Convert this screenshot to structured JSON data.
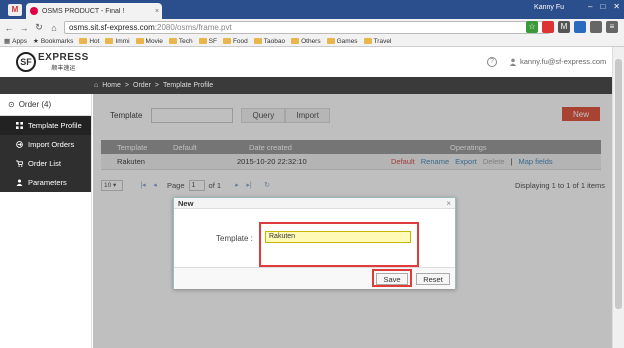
{
  "browser": {
    "gmail_badge": "M",
    "tab_title": "OSMS PRODUCT - Final !",
    "tab_close": "×",
    "user": "Kanny Fu",
    "url_host": "osms.sit.sf-express.com",
    "url_rest": ":2080/osms/frame.pvt",
    "bookmarks": [
      "Apps",
      "Bookmarks",
      "Hot",
      "Immi",
      "Movie",
      "Tech",
      "SF",
      "Food",
      "Taobao",
      "Others",
      "Games",
      "Travel"
    ]
  },
  "header": {
    "logo_mark": "SF",
    "logo_en": "EXPRESS",
    "logo_cn": "顺丰速运",
    "help": "?",
    "user_email": "kanny.fu@sf-express.com"
  },
  "breadcrumb": {
    "home": "Home",
    "sep1": ">",
    "order": "Order",
    "sep2": ">",
    "current": "Template Profile"
  },
  "sidebar": {
    "section": "Order (4)",
    "items": [
      {
        "label": "Template Profile",
        "icon": "grid-icon"
      },
      {
        "label": "Import Orders",
        "icon": "import-icon"
      },
      {
        "label": "Order List",
        "icon": "cart-icon"
      },
      {
        "label": "Parameters",
        "icon": "person-icon"
      }
    ]
  },
  "search": {
    "template_label": "Template",
    "query_label": "Query",
    "import_label": "Import",
    "new_label": "New"
  },
  "grid": {
    "columns": [
      "Template",
      "Default",
      "Date created",
      "Operatings"
    ],
    "rows": [
      {
        "template": "Rakuten",
        "default": "",
        "date": "2015-10-20 22:32:10"
      }
    ],
    "ops": {
      "default": "Default",
      "rename": "Rename",
      "export": "Export",
      "delete": "Delete",
      "sep": "|",
      "map": "Map fields"
    }
  },
  "pager": {
    "page_size": "10",
    "page_label": "Page",
    "page_value": "1",
    "of_label": "of 1",
    "display": "Displaying 1 to 1 of 1 items"
  },
  "dialog": {
    "title": "New",
    "close": "×",
    "template_label": "Template :",
    "template_value": "Rakuten",
    "save_label": "Save",
    "reset_label": "Reset"
  }
}
